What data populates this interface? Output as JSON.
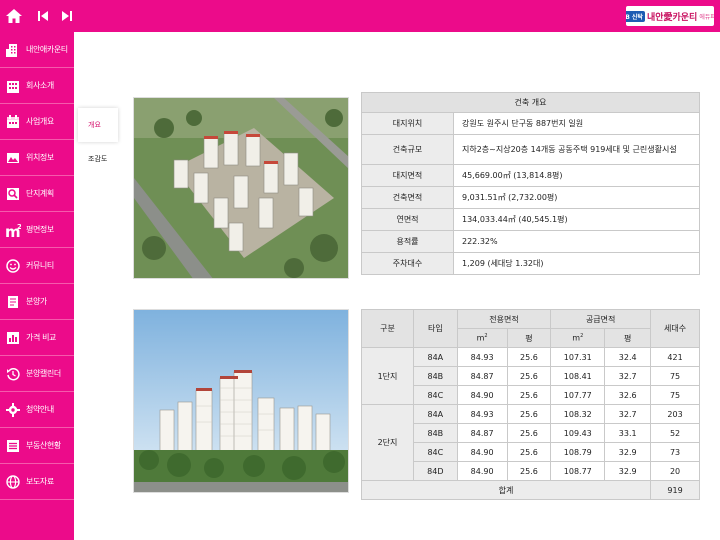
{
  "brand": {
    "badge": "KB 신탁",
    "name": "내안愛카운티",
    "sub": "에듀파크"
  },
  "sidebar": {
    "items": [
      {
        "label": "내안애카운티",
        "icon": "building-icon"
      },
      {
        "label": "회사소개",
        "icon": "office-icon"
      },
      {
        "label": "사업개요",
        "icon": "calendar-icon"
      },
      {
        "label": "위치정보",
        "icon": "photo-icon"
      },
      {
        "label": "단지계획",
        "icon": "search-icon"
      },
      {
        "label": "평면정보",
        "icon": "square-meter-icon"
      },
      {
        "label": "커뮤니티",
        "icon": "smile-icon"
      },
      {
        "label": "분양가",
        "icon": "document-icon"
      },
      {
        "label": "가격 비교",
        "icon": "bar-chart-icon"
      },
      {
        "label": "분양캘린더",
        "icon": "history-icon"
      },
      {
        "label": "청약안내",
        "icon": "gear-icon"
      },
      {
        "label": "부동산현황",
        "icon": "list-icon"
      },
      {
        "label": "보도자료",
        "icon": "globe-icon"
      }
    ]
  },
  "subnav": {
    "items": [
      "개요",
      "조감도"
    ]
  },
  "overview": {
    "caption": "건축 개요",
    "rows": [
      {
        "key": "대지위치",
        "value": "강원도 원주시 단구동 887번지 일원"
      },
      {
        "key": "건축규모",
        "value": "지하2층~지상20층 14개동 공동주택 919세대 및 근린생활시설"
      },
      {
        "key": "대지면적",
        "value": "45,669.00㎡ (13,814.8평)"
      },
      {
        "key": "건축면적",
        "value": "9,031.51㎡ (2,732.00평)"
      },
      {
        "key": "연면적",
        "value": "134,033.44㎡ (40,545.1평)"
      },
      {
        "key": "용적률",
        "value": "222.32%"
      },
      {
        "key": "주차대수",
        "value": "1,209 (세대당 1.32대)"
      }
    ]
  },
  "units": {
    "headers": {
      "division": "구분",
      "type": "타입",
      "exclusive": "전용면적",
      "supply": "공급면적",
      "households": "세대수",
      "sqm": "m",
      "sqm_exp": "2",
      "pyeong": "평"
    },
    "groups": [
      {
        "name": "1단지",
        "rows": [
          [
            "84A",
            "84.93",
            "25.6",
            "107.31",
            "32.4",
            "421"
          ],
          [
            "84B",
            "84.87",
            "25.6",
            "108.41",
            "32.7",
            "75"
          ],
          [
            "84C",
            "84.90",
            "25.6",
            "107.77",
            "32.6",
            "75"
          ]
        ]
      },
      {
        "name": "2단지",
        "rows": [
          [
            "84A",
            "84.93",
            "25.6",
            "108.32",
            "32.7",
            "203"
          ],
          [
            "84B",
            "84.87",
            "25.6",
            "109.43",
            "33.1",
            "52"
          ],
          [
            "84C",
            "84.90",
            "25.6",
            "108.79",
            "32.9",
            "73"
          ],
          [
            "84D",
            "84.90",
            "25.6",
            "108.77",
            "32.9",
            "20"
          ]
        ]
      }
    ],
    "total_label": "합계",
    "total_value": "919"
  }
}
